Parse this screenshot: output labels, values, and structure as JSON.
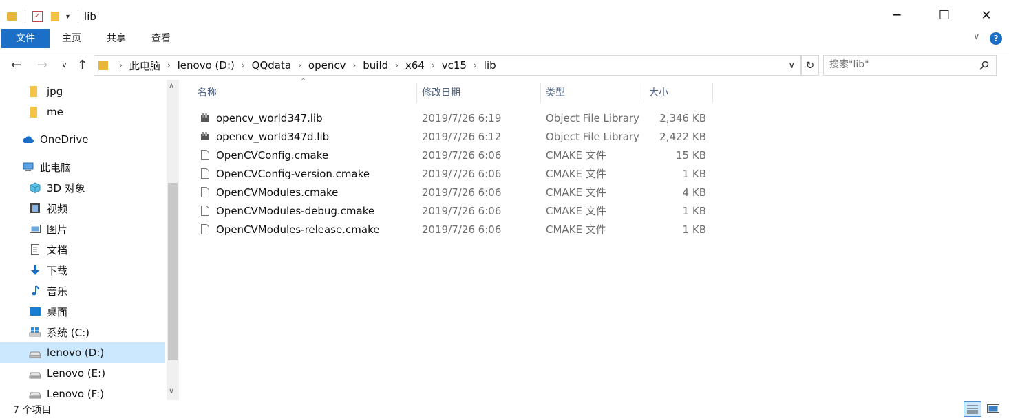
{
  "window": {
    "title": "lib",
    "minimize_glyph": "─",
    "maximize_glyph": "☐",
    "close_glyph": "✕"
  },
  "ribbon": {
    "tabs": [
      "文件",
      "主页",
      "共享",
      "查看"
    ],
    "collapse_glyph": "∨",
    "help_glyph": "?"
  },
  "nav_buttons": {
    "back": "←",
    "forward": "→",
    "recent": "∨",
    "up": "↑"
  },
  "address": {
    "crumbs": [
      "此电脑",
      "lenovo (D:)",
      "QQdata",
      "opencv",
      "build",
      "x64",
      "vc15",
      "lib"
    ],
    "separator": "›",
    "dropdown_glyph": "∨",
    "refresh_glyph": "↻"
  },
  "search": {
    "placeholder": "搜索\"lib\"",
    "icon": "search-icon"
  },
  "sidebar": {
    "items": [
      {
        "label": "jpg",
        "icon": "folder-icon"
      },
      {
        "label": "me",
        "icon": "folder-icon"
      },
      {
        "label": "OneDrive",
        "icon": "cloud-icon"
      },
      {
        "label": "此电脑",
        "icon": "computer-icon"
      },
      {
        "label": "3D 对象",
        "icon": "cube-icon"
      },
      {
        "label": "视频",
        "icon": "video-icon"
      },
      {
        "label": "图片",
        "icon": "picture-icon"
      },
      {
        "label": "文档",
        "icon": "document-icon"
      },
      {
        "label": "下载",
        "icon": "download-icon"
      },
      {
        "label": "音乐",
        "icon": "music-icon"
      },
      {
        "label": "桌面",
        "icon": "desktop-icon"
      },
      {
        "label": "系统 (C:)",
        "icon": "windows-drive-icon"
      },
      {
        "label": "lenovo (D:)",
        "icon": "drive-icon"
      },
      {
        "label": "Lenovo (E:)",
        "icon": "drive-icon"
      },
      {
        "label": "Lenovo (F:)",
        "icon": "drive-icon"
      }
    ],
    "selected_index": 12,
    "scroll_up": "∧",
    "scroll_down": "∨"
  },
  "columns": {
    "name": "名称",
    "date": "修改日期",
    "type": "类型",
    "size": "大小",
    "sort_glyph": "^"
  },
  "files": [
    {
      "name": "opencv_world347.lib",
      "date": "2019/7/26 6:19",
      "type": "Object File Library",
      "size": "2,346 KB",
      "icon": "library-file-icon"
    },
    {
      "name": "opencv_world347d.lib",
      "date": "2019/7/26 6:12",
      "type": "Object File Library",
      "size": "2,422 KB",
      "icon": "library-file-icon"
    },
    {
      "name": "OpenCVConfig.cmake",
      "date": "2019/7/26 6:06",
      "type": "CMAKE 文件",
      "size": "15 KB",
      "icon": "blank-file-icon"
    },
    {
      "name": "OpenCVConfig-version.cmake",
      "date": "2019/7/26 6:06",
      "type": "CMAKE 文件",
      "size": "1 KB",
      "icon": "blank-file-icon"
    },
    {
      "name": "OpenCVModules.cmake",
      "date": "2019/7/26 6:06",
      "type": "CMAKE 文件",
      "size": "4 KB",
      "icon": "blank-file-icon"
    },
    {
      "name": "OpenCVModules-debug.cmake",
      "date": "2019/7/26 6:06",
      "type": "CMAKE 文件",
      "size": "1 KB",
      "icon": "blank-file-icon"
    },
    {
      "name": "OpenCVModules-release.cmake",
      "date": "2019/7/26 6:06",
      "type": "CMAKE 文件",
      "size": "1 KB",
      "icon": "blank-file-icon"
    }
  ],
  "status": {
    "item_count": "7 个项目"
  },
  "colors": {
    "accent": "#1c6fc7",
    "selected": "#cce8ff",
    "header_text": "#4d6082",
    "secondary_text": "#6d6d6d"
  }
}
